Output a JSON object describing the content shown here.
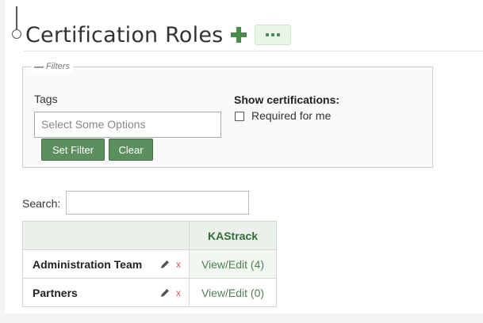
{
  "page": {
    "title": "Certification Roles"
  },
  "filters": {
    "legend": "Filters",
    "tags_label": "Tags",
    "tags_placeholder": "Select Some Options",
    "set_filter_label": "Set Filter",
    "clear_label": "Clear",
    "show_certifications_label": "Show certifications:",
    "required_for_me_label": "Required for me"
  },
  "search": {
    "label": "Search:",
    "value": ""
  },
  "table": {
    "columns": [
      "",
      "KAStrack"
    ],
    "rows": [
      {
        "name": "Administration Team",
        "link": "View/Edit (4)",
        "delete": "x"
      },
      {
        "name": "Partners",
        "link": "View/Edit (0)",
        "delete": "x"
      }
    ]
  },
  "colors": {
    "accent_green": "#5b8f5e",
    "link_green": "#4f7f52",
    "delete_red": "#d9534f",
    "header_bg": "#eaf0ea"
  },
  "icons": {
    "add": "plus-icon",
    "more": "ellipsis-icon",
    "edit": "pencil-icon",
    "delete": "close-icon",
    "collapse": "minus-icon"
  }
}
